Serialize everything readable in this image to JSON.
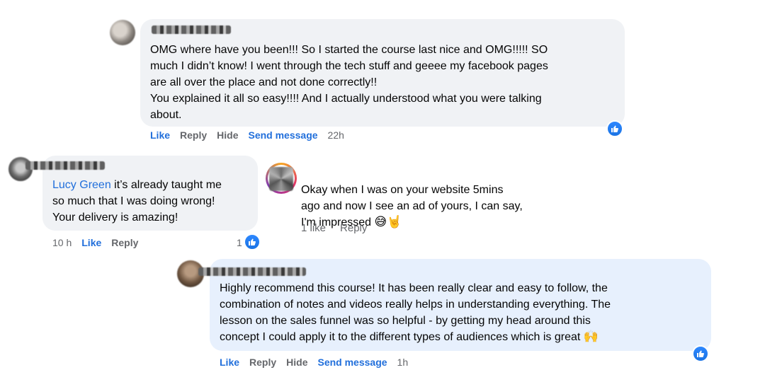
{
  "comments": [
    {
      "text": "OMG where have you been!!! So I started the course last nice and OMG!!!!! SO\nmuch I didn’t know! I went through the tech stuff and geeee my facebook pages\nare all over the place and not done correctly!!\nYou explained it all so easy!!!! And I actually understood what you were talking\nabout.",
      "actions": {
        "like": "Like",
        "reply": "Reply",
        "hide": "Hide",
        "send": "Send message"
      },
      "time": "22h"
    },
    {
      "mention": "Lucy Green",
      "text": " it’s already taught me\nso much that I was doing wrong!\nYour delivery is amazing!",
      "time": "10 h",
      "actions": {
        "like": "Like",
        "reply": "Reply"
      },
      "reaction_count": "1"
    },
    {
      "text": "Okay when I was on your website 5mins\nago and now I see an ad of yours, I can say,\nI'm impressed ",
      "emojis": "😅🤘",
      "likes": "1 like",
      "actions": {
        "reply": "Reply"
      }
    },
    {
      "text": "Highly recommend this course! It has been really clear and easy to follow, the\ncombination of notes and videos really helps in understanding everything. The\nlesson on the sales funnel was so helpful - by getting my head around this\nconcept I could apply it to the different types of audiences which is great ",
      "emoji": "🙌",
      "actions": {
        "like": "Like",
        "reply": "Reply",
        "hide": "Hide",
        "send": "Send message"
      },
      "time": "1h"
    }
  ],
  "colors": {
    "link": "#216fdb",
    "muted": "#65676b",
    "bubble_grey": "#f0f2f5",
    "bubble_blue": "#e7f0fd"
  }
}
